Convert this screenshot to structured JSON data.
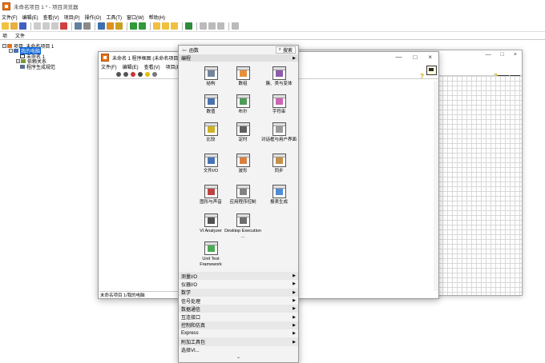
{
  "project_window": {
    "title": "未命名项目 1 * - 项目浏览器",
    "menus": [
      "文件(F)",
      "编辑(E)",
      "查看(V)",
      "项目(P)",
      "操作(O)",
      "工具(T)",
      "窗口(W)",
      "帮助(H)"
    ],
    "tabs": [
      "项",
      "文件"
    ],
    "tree": [
      {
        "label": "项目: 未命名项目 1",
        "level": 0,
        "selected": false
      },
      {
        "label": "我的电脑",
        "level": 1,
        "selected": true
      },
      {
        "label": "未命名 1",
        "level": 2,
        "selected": false
      },
      {
        "label": "依赖关系",
        "level": 2,
        "selected": false
      },
      {
        "label": "程序生成规范",
        "level": 2,
        "selected": false
      }
    ]
  },
  "front_panel": {
    "controls": [
      "—",
      "□",
      "×"
    ],
    "help": "?"
  },
  "block_diagram": {
    "title": "未命名 1 程序框图 (未命名项目 1/我",
    "menus": [
      "文件(F)",
      "编辑(E)",
      "查看(V)",
      "项目(P)"
    ],
    "window_controls": [
      "—",
      "□",
      "×"
    ],
    "help": "?",
    "status": "未命名项目 1/我的电脑"
  },
  "palette": {
    "title": "函数",
    "search_label": "搜索",
    "section": "编程",
    "items": [
      {
        "label": "结构",
        "color": "#5a6e8c"
      },
      {
        "label": "数组",
        "color": "#e07c1a"
      },
      {
        "label": "簇、类与变体",
        "color": "#7a3f9e"
      },
      {
        "label": "数值",
        "color": "#2c5aa0"
      },
      {
        "label": "布尔",
        "color": "#2e8b3a"
      },
      {
        "label": "字符串",
        "color": "#c44aa6"
      },
      {
        "label": "比较",
        "color": "#c8a400"
      },
      {
        "label": "定时",
        "color": "#444444"
      },
      {
        "label": "对话框与用户界面",
        "color": "#8a8a8a"
      },
      {
        "label": "文件I/O",
        "color": "#2a5aa8"
      },
      {
        "label": "波形",
        "color": "#d26a1e"
      },
      {
        "label": "同步",
        "color": "#bb7d2a"
      },
      {
        "label": "图形与声音",
        "color": "#b22222"
      },
      {
        "label": "应用程序控制",
        "color": "#6c6c6c"
      },
      {
        "label": "报表生成",
        "color": "#3377cc"
      },
      {
        "label": "VI Analyzer",
        "color": "#333333"
      },
      {
        "label": "Desktop Execution ...",
        "color": "#555555"
      },
      {
        "label": "Unit Test Framework",
        "color": "#2e9a3a"
      },
      {
        "label": "",
        "color": "#666666"
      },
      {
        "label": "",
        "color": "#666666"
      }
    ],
    "categories": [
      "测量I/O",
      "仪器I/O",
      "数学",
      "信号处理",
      "数据通信",
      "互连接口",
      "控制和仿真",
      "Express",
      "附加工具包",
      "选择VI..."
    ],
    "more": "⌄"
  }
}
